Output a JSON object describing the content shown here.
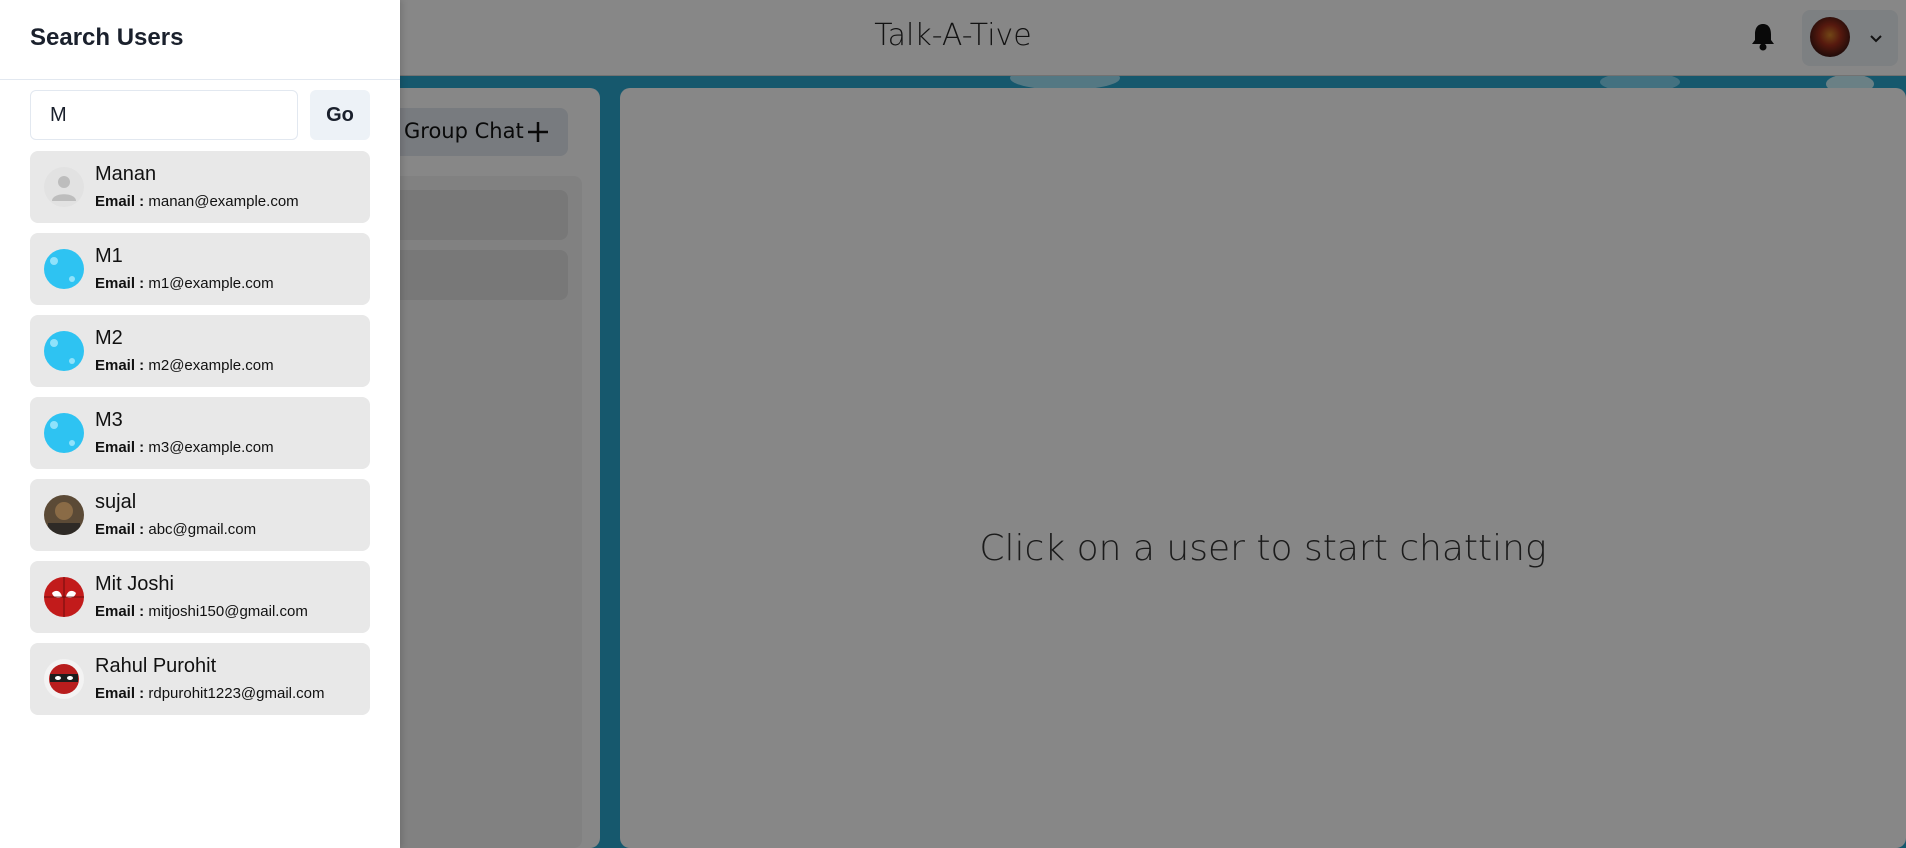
{
  "app": {
    "title": "Talk-A-Tive",
    "group_chat_label": "Group Chat",
    "empty_chat_message": "Click on a user to start chatting",
    "accent": "#2aa6cf"
  },
  "header_icons": {
    "notification": "bell-icon",
    "profile_menu": "chevron-down-icon"
  },
  "drawer": {
    "title": "Search Users",
    "search_value": "M",
    "go_label": "Go",
    "email_key": "Email :",
    "results": [
      {
        "name": "Manan",
        "email": "manan@example.com",
        "avatar": "default-user"
      },
      {
        "name": "M1",
        "email": "m1@example.com",
        "avatar": "blue-bubbles"
      },
      {
        "name": "M2",
        "email": "m2@example.com",
        "avatar": "blue-bubbles"
      },
      {
        "name": "M3",
        "email": "m3@example.com",
        "avatar": "blue-bubbles"
      },
      {
        "name": "sujal",
        "email": "abc@gmail.com",
        "avatar": "photo"
      },
      {
        "name": "Mit Joshi",
        "email": "mitjoshi150@gmail.com",
        "avatar": "spiderman"
      },
      {
        "name": "Rahul Purohit",
        "email": "rdpurohit1223@gmail.com",
        "avatar": "deadpool"
      }
    ]
  }
}
